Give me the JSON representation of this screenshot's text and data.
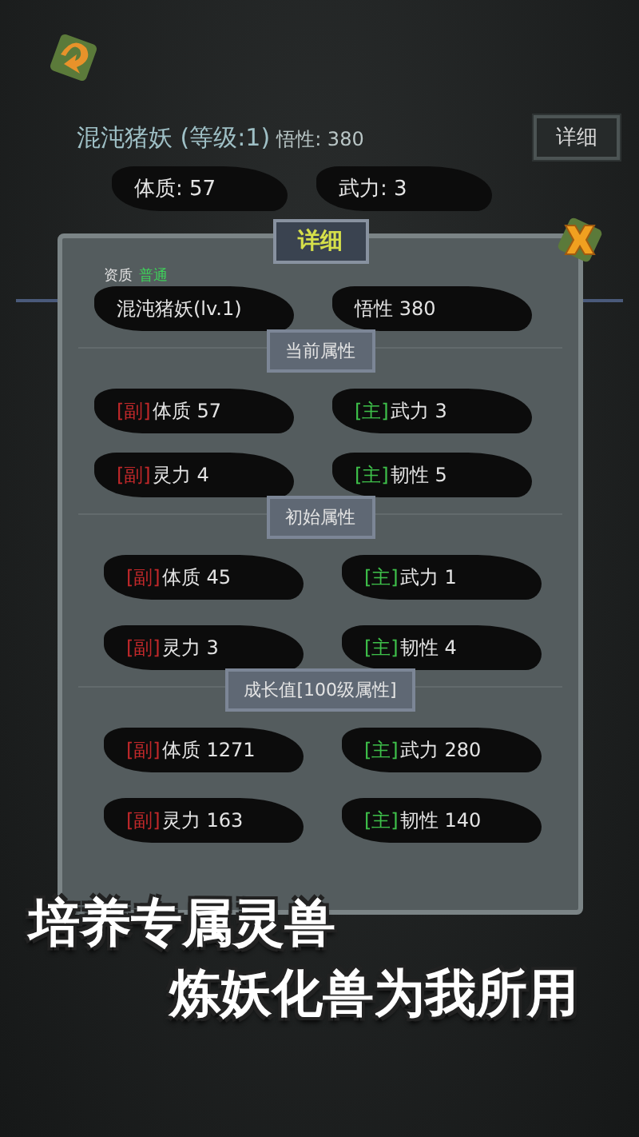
{
  "header": {
    "title": "混沌猪妖 (等级:1)",
    "insight": "悟性: 380",
    "detail_button": "详细",
    "stats": [
      "体质: 57",
      "武力: 3"
    ]
  },
  "modal": {
    "title": "详细",
    "grade_label": "资质",
    "grade": "普通",
    "strips": [
      "混沌猪妖(lv.1)",
      "悟性 380"
    ],
    "sections": [
      {
        "title": "当前属性",
        "stats": [
          {
            "kind": "sub",
            "tag": "[副]",
            "text": "体质 57"
          },
          {
            "kind": "main",
            "tag": "[主]",
            "text": "武力 3"
          },
          {
            "kind": "sub",
            "tag": "[副]",
            "text": "灵力 4"
          },
          {
            "kind": "main",
            "tag": "[主]",
            "text": "韧性 5"
          }
        ]
      },
      {
        "title": "初始属性",
        "stats": [
          {
            "kind": "sub",
            "tag": "[副]",
            "text": "体质 45"
          },
          {
            "kind": "main",
            "tag": "[主]",
            "text": "武力 1"
          },
          {
            "kind": "sub",
            "tag": "[副]",
            "text": "灵力 3"
          },
          {
            "kind": "main",
            "tag": "[主]",
            "text": "韧性 4"
          }
        ]
      },
      {
        "title": "成长值[100级属性]",
        "stats": [
          {
            "kind": "sub",
            "tag": "[副]",
            "text": "体质 1271"
          },
          {
            "kind": "main",
            "tag": "[主]",
            "text": "武力 280"
          },
          {
            "kind": "sub",
            "tag": "[副]",
            "text": "灵力 163"
          },
          {
            "kind": "main",
            "tag": "[主]",
            "text": "韧性 140"
          }
        ]
      }
    ]
  },
  "captions": [
    "培养专属灵兽",
    "炼妖化兽为我所用"
  ]
}
